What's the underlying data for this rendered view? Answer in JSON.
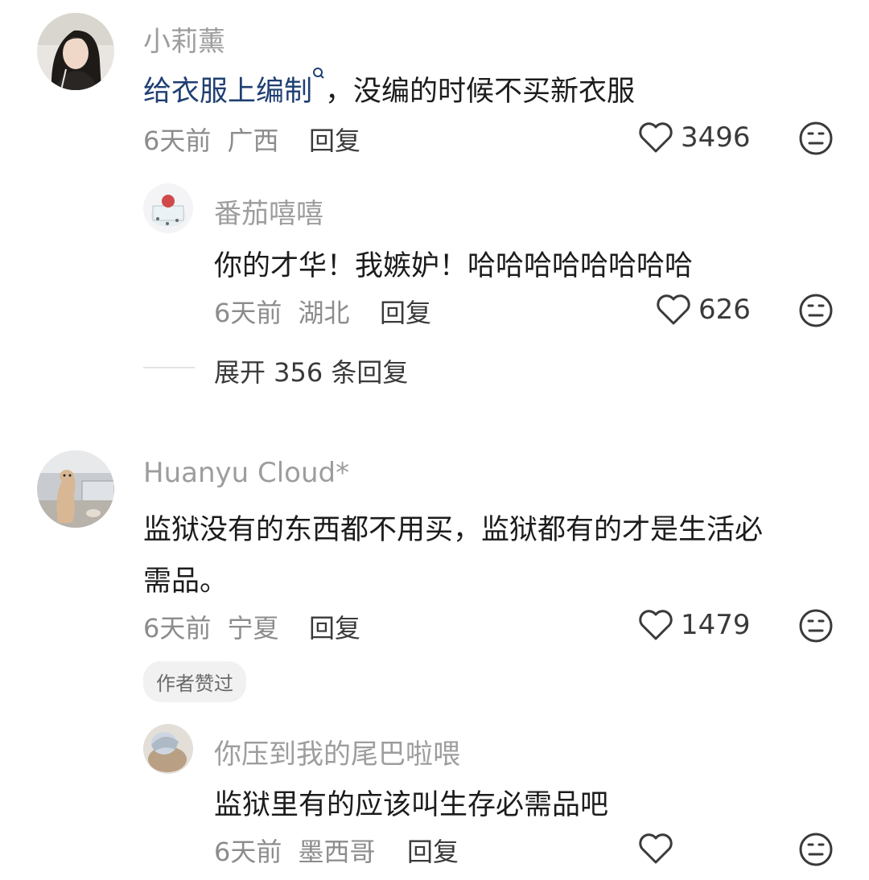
{
  "comments": [
    {
      "username": "小莉薰",
      "content_link": "给衣服上编制",
      "content_rest": "，没编的时候不买新衣服",
      "time": "6天前",
      "location": "广西",
      "reply_label": "回复",
      "likes": "3496",
      "replies": [
        {
          "username": "番茄嘻嘻",
          "content": "你的才华！我嫉妒！哈哈哈哈哈哈哈哈",
          "time": "6天前",
          "location": "湖北",
          "reply_label": "回复",
          "likes": "626"
        }
      ],
      "expand_label": "展开 356 条回复"
    },
    {
      "username": "Huanyu Cloud*",
      "content_line1": "监狱没有的东西都不用买，监狱都有的才是生活必",
      "content_line2": "需品。",
      "time": "6天前",
      "location": "宁夏",
      "reply_label": "回复",
      "likes": "1479",
      "badge": "作者赞过",
      "replies": [
        {
          "username": "你压到我的尾巴啦喂",
          "content": "监狱里有的应该叫生存必需品吧",
          "time": "6天前",
          "location": "墨西哥",
          "reply_label": "回复"
        }
      ]
    }
  ],
  "colors": {
    "background": "#ffffff",
    "text_primary": "#1c1c1c",
    "text_secondary": "#8c8c8c",
    "username": "#9d9d9d",
    "link": "#1f3f73"
  },
  "icons": [
    "heart-icon",
    "dislike-face-icon",
    "search-icon"
  ]
}
